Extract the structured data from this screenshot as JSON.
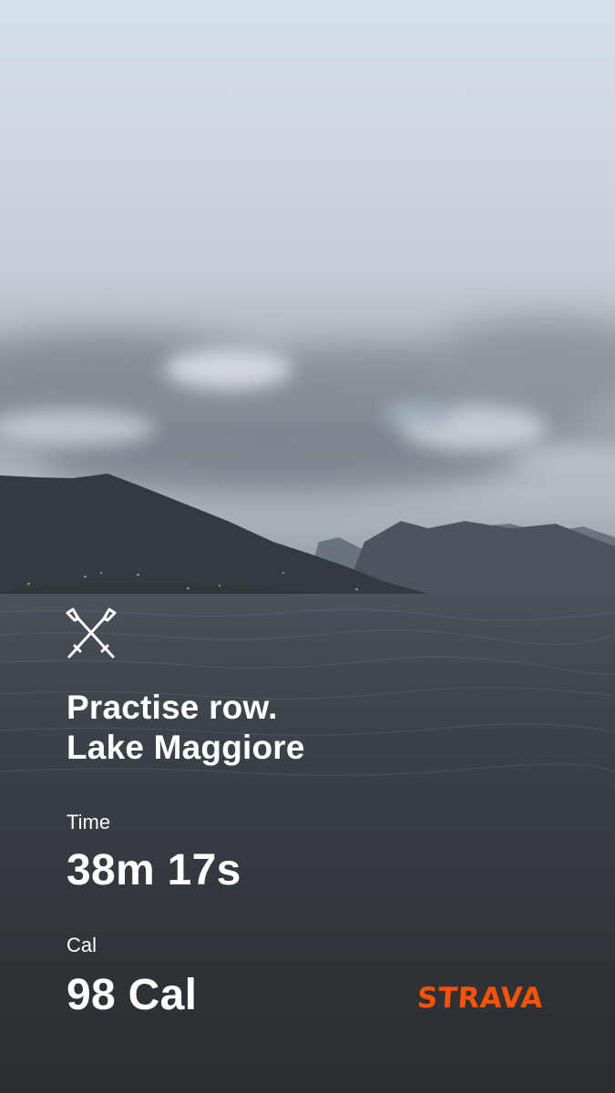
{
  "activity": {
    "title_line1": "Practise row.",
    "title_line2": "Lake Maggiore",
    "icon": "rowing-oars-icon"
  },
  "stats": {
    "time": {
      "label": "Time",
      "value": "38m 17s"
    },
    "calories": {
      "label": "Cal",
      "value": "98 Cal"
    }
  },
  "brand": {
    "name": "STRAVA",
    "color": "#fc5200"
  },
  "colors": {
    "text": "#ffffff",
    "sky_top": "#d6e0ea",
    "water_bottom": "#2a2d31"
  }
}
